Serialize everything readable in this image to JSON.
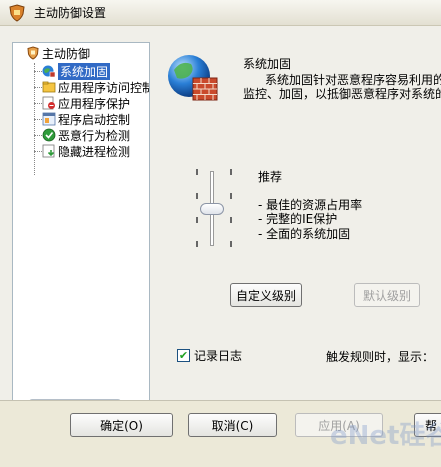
{
  "window": {
    "title": "主动防御设置"
  },
  "tree": {
    "root": "主动防御",
    "items": [
      {
        "label": "系统加固",
        "icon": "system-harden-icon",
        "selected": true
      },
      {
        "label": "应用程序访问控制",
        "icon": "app-access-control-icon",
        "selected": false
      },
      {
        "label": "应用程序保护",
        "icon": "app-protect-icon",
        "selected": false
      },
      {
        "label": "程序启动控制",
        "icon": "startup-control-icon",
        "selected": false
      },
      {
        "label": "恶意行为检测",
        "icon": "malicious-behavior-icon",
        "selected": false
      },
      {
        "label": "隐藏进程检测",
        "icon": "hidden-process-icon",
        "selected": false
      }
    ]
  },
  "section": {
    "title": "系统加固",
    "desc_line1": "系统加固针对恶意程序容易利用的",
    "desc_line2": "监控、加固，以抵御恶意程序对系统的"
  },
  "level": {
    "name": "推荐",
    "lines": [
      "- 最佳的资源占用率",
      "- 完整的IE保护",
      "- 全面的系统加固"
    ],
    "slider_position": 0.5
  },
  "buttons": {
    "custom": "自定义级别",
    "default": "默认级别",
    "ok": "确定(O)",
    "cancel": "取消(C)",
    "apply": "应用(A)",
    "help": "帮"
  },
  "options": {
    "log_label": "记录日志",
    "log_checked": true,
    "rule_label": "触发规则时，显示："
  },
  "watermark": "eNet硅谷动力",
  "colors": {
    "selection": "#316ac5",
    "accent_green": "#21a121"
  }
}
